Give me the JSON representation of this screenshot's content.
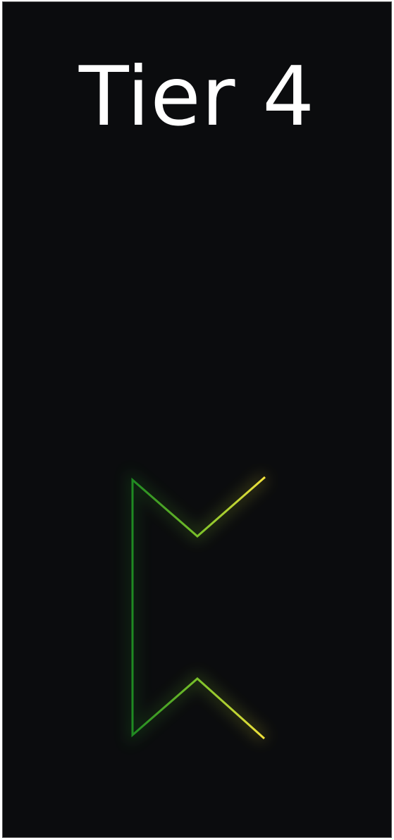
{
  "title": "Tier 4",
  "colors": {
    "background": "#0b0c0e",
    "stroke_start": "#1f8a22",
    "stroke_mid": "#7cc22a",
    "stroke_end": "#f3e23c"
  },
  "icons": {
    "emblem": "chevron-bracket-emblem"
  }
}
